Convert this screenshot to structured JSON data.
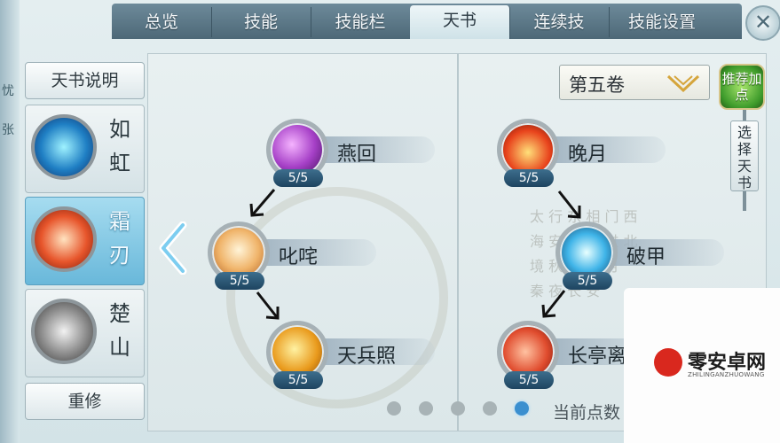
{
  "tabs": [
    "总览",
    "技能",
    "技能栏",
    "天书",
    "连续技",
    "技能设置"
  ],
  "active_tab": "天书",
  "close_label": "✕",
  "left_strip": [
    "忧",
    "张"
  ],
  "sidebar": {
    "top_button": "天书说明",
    "bottom_button": "重修",
    "characters": [
      {
        "name": "如虹",
        "chars": [
          "如",
          "虹"
        ],
        "orb": "blue"
      },
      {
        "name": "霜刃",
        "chars": [
          "霜",
          "刃"
        ],
        "orb": "red",
        "active": true
      },
      {
        "name": "楚山",
        "chars": [
          "楚",
          "山"
        ],
        "orb": "gray"
      }
    ]
  },
  "left_column": [
    {
      "name": "燕回",
      "level": "5/5",
      "icon": "purple"
    },
    {
      "name": "叱咤",
      "level": "5/5",
      "icon": "sun"
    },
    {
      "name": "天兵照",
      "level": "5/5",
      "icon": "gold"
    }
  ],
  "right_column": [
    {
      "name": "晚月",
      "level": "5/5",
      "icon": "fire"
    },
    {
      "name": "破甲",
      "level": "5/5",
      "icon": "ice"
    },
    {
      "name": "长亭离",
      "level": "5/5",
      "icon": "crimson"
    }
  ],
  "volume": {
    "label": "第五卷"
  },
  "recommend_label": "推荐加点",
  "select_book_label": "选择天书",
  "pager": {
    "count": 5,
    "active_index": 4
  },
  "points_label": "当前点数",
  "background_text": [
    "太",
    "行",
    "东",
    "相",
    "门",
    "西",
    "海",
    "安",
    "杨",
    "风",
    "过",
    "北",
    "境",
    "秋",
    "相",
    "利",
    "月",
    "秦",
    "夜",
    "长",
    "安"
  ],
  "watermark": {
    "name": "零安卓网",
    "sub": "ZHILINGANZHUOWANG"
  }
}
